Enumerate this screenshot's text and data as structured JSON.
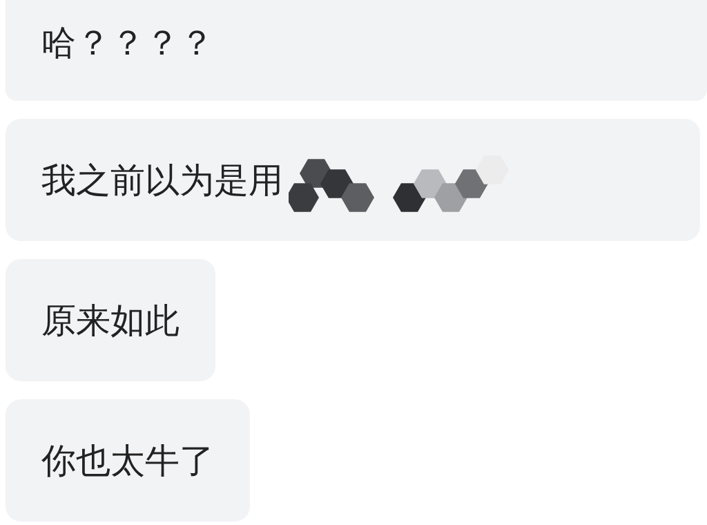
{
  "messages": [
    {
      "text": "哈？？？？",
      "redacted": false
    },
    {
      "text": "我之前以为是用",
      "redacted": true
    },
    {
      "text": "原来如此",
      "redacted": false
    },
    {
      "text": "你也太牛了",
      "redacted": false
    }
  ]
}
